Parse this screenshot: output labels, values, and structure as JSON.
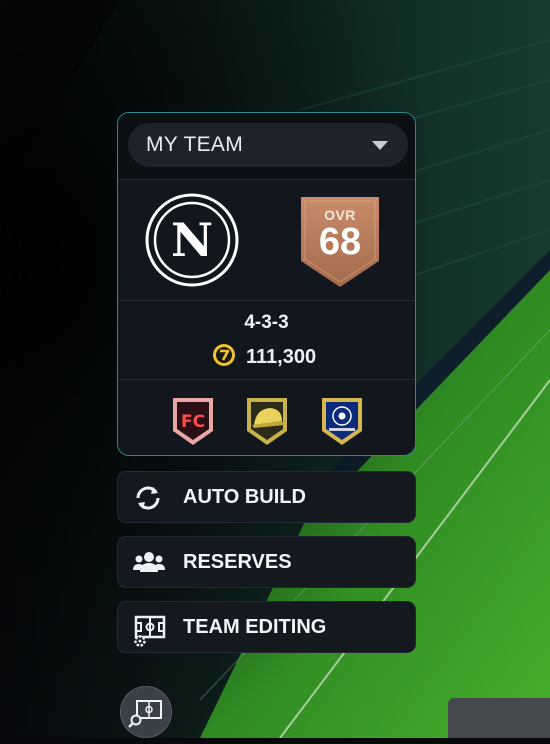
{
  "team_selector": {
    "label": "MY TEAM"
  },
  "club": {
    "crest_icon": "napoli-crest-icon",
    "crest_letter": "N"
  },
  "rating": {
    "label": "OVR",
    "value": "68"
  },
  "formation": "4-3-3",
  "coins": {
    "icon": "coin-icon",
    "value": "111,300"
  },
  "badges": [
    {
      "name": "fc-badge-icon"
    },
    {
      "name": "cap-badge-icon"
    },
    {
      "name": "champions-league-badge-icon"
    }
  ],
  "menu": [
    {
      "label": "AUTO BUILD",
      "icon": "refresh-icon"
    },
    {
      "label": "RESERVES",
      "icon": "group-icon"
    },
    {
      "label": "TEAM EDITING",
      "icon": "pitch-settings-icon"
    }
  ],
  "colors": {
    "panel_border": "#2a8c8a",
    "ovr_bronze": "#b77a5a",
    "coin_gold": "#f1c230"
  }
}
